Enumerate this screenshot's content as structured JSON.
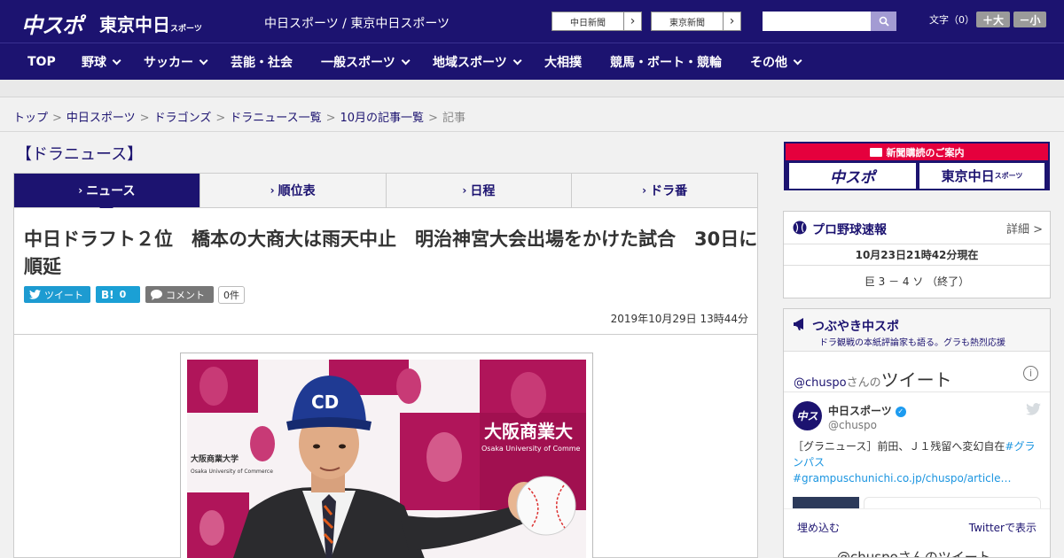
{
  "header": {
    "logo_main": "中スポ",
    "logo_tokyo": "東京中日",
    "logo_tokyo_small": "スポーツ",
    "site_title": "中日スポーツ / 東京中日スポーツ",
    "paper_buttons": [
      "中日新聞",
      "東京新聞"
    ],
    "search_placeholder": "",
    "font_size_label": "文字（0）",
    "font_larger": "＋大",
    "font_smaller": "－小"
  },
  "nav": {
    "items": [
      {
        "label": "TOP",
        "dropdown": false
      },
      {
        "label": "野球",
        "dropdown": true
      },
      {
        "label": "サッカー",
        "dropdown": true
      },
      {
        "label": "芸能・社会",
        "dropdown": false
      },
      {
        "label": "一般スポーツ",
        "dropdown": true
      },
      {
        "label": "地域スポーツ",
        "dropdown": true
      },
      {
        "label": "大相撲",
        "dropdown": false
      },
      {
        "label": "競馬・ボート・競輪",
        "dropdown": false
      },
      {
        "label": "その他",
        "dropdown": true
      }
    ]
  },
  "breadcrumb": {
    "links": [
      "トップ",
      "中日スポーツ",
      "ドラゴンズ",
      "ドラニュース一覧",
      "10月の記事一覧"
    ],
    "current": "記事",
    "separator": ">"
  },
  "section": {
    "title": "【ドラニュース】"
  },
  "tabs": [
    {
      "label": "ニュース",
      "active": true
    },
    {
      "label": "順位表",
      "active": false
    },
    {
      "label": "日程",
      "active": false
    },
    {
      "label": "ドラ番",
      "active": false
    }
  ],
  "article": {
    "headline": "中日ドラフト２位　橋本の大商大は雨天中止　明治神宮大会出場をかけた試合　30日に順延",
    "share_tweet": "ツイート",
    "share_hatena_label": "B!",
    "share_hatena_count": "0",
    "share_comment": "コメント",
    "comment_count": "0件",
    "timestamp": "2019年10月29日 13時44分",
    "photo": {
      "banner_text": "大阪商業大",
      "banner_en": "Osaka University of Comme",
      "small_text_1": "大阪商業大学",
      "small_text_2": "Osaka University of Commerce",
      "cap_letters": "CD"
    }
  },
  "sidebar": {
    "ad": {
      "header": "新聞購読のご案内",
      "logo1": "中スポ",
      "logo2": "東京中日",
      "logo2_small": "スポーツ"
    },
    "score": {
      "title": "プロ野球速報",
      "detail": "詳細 >",
      "time": "10月23日21時42分現在",
      "line": "巨 3 － 4 ソ （終了）"
    },
    "tweets": {
      "title": "つぶやき中スポ",
      "subtitle": "ドラ観戦の本紙評論家も語る。グラも熱烈応援",
      "handle": "@chuspo",
      "handle_suffix": "さんの",
      "handle_big": "ツイート",
      "avatar_text": "中ス",
      "name": "中日スポーツ",
      "at": "@chuspo",
      "text_plain": "［グラニュース］前田、Ｊ１残留へ変幻自在",
      "text_tag": "#グランパス",
      "text_link": "#grampuschunichi.co.jp/chuspo/article…",
      "embed": "埋め込む",
      "view_on_twitter": "Twitterで表示",
      "more": "@chuspoさんのツイート"
    }
  },
  "colors": {
    "brand": "#1c1370",
    "accent": "#e5003d",
    "twitter": "#1d9bd1"
  }
}
